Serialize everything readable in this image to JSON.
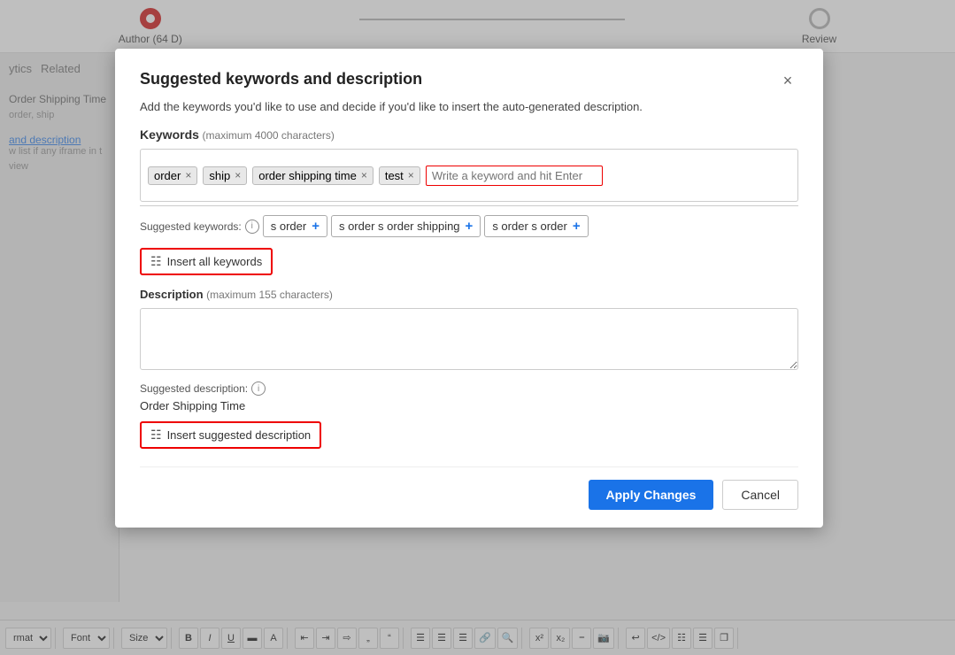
{
  "page": {
    "bg_color": "#e8e8e8"
  },
  "stepper": {
    "step1_label": "Author (64 D)",
    "step2_label": "Review"
  },
  "sidebar": {
    "nav_item1": "ytics",
    "nav_item2": "Related",
    "item_title": "Order Shipping Time",
    "item_subtitle": "order, ship",
    "link_text": "and description",
    "small_text": "w list if any iframe in t",
    "view_text": "view"
  },
  "modal": {
    "title": "Suggested keywords and description",
    "subtitle": "Add the keywords you'd like to use and decide if you'd like to insert the auto-generated description.",
    "close_label": "×",
    "keywords_section_label": "Keywords",
    "keywords_max_hint": "(maximum 4000 characters)",
    "tags": [
      {
        "text": "order"
      },
      {
        "text": "ship"
      },
      {
        "text": "order shipping time"
      },
      {
        "text": "test"
      }
    ],
    "keyword_input_placeholder": "Write a keyword and hit Enter",
    "suggested_keywords_label": "Suggested keywords:",
    "suggested_chips": [
      {
        "label": "s order"
      },
      {
        "label": "s order s order shipping"
      },
      {
        "label": "s order s order"
      }
    ],
    "insert_all_btn_label": "Insert all keywords",
    "description_section_label": "Description",
    "description_max_hint": "(maximum 155 characters)",
    "description_placeholder": "",
    "suggested_description_label": "Suggested description:",
    "suggested_description_text": "Order Shipping Time",
    "insert_desc_btn_label": "Insert suggested description",
    "apply_btn_label": "Apply Changes",
    "cancel_btn_label": "Cancel"
  },
  "toolbar": {
    "format_label": "rmat",
    "font_label": "Font",
    "size_label": "Size",
    "bold_label": "B",
    "italic_label": "I",
    "underline_label": "U"
  }
}
